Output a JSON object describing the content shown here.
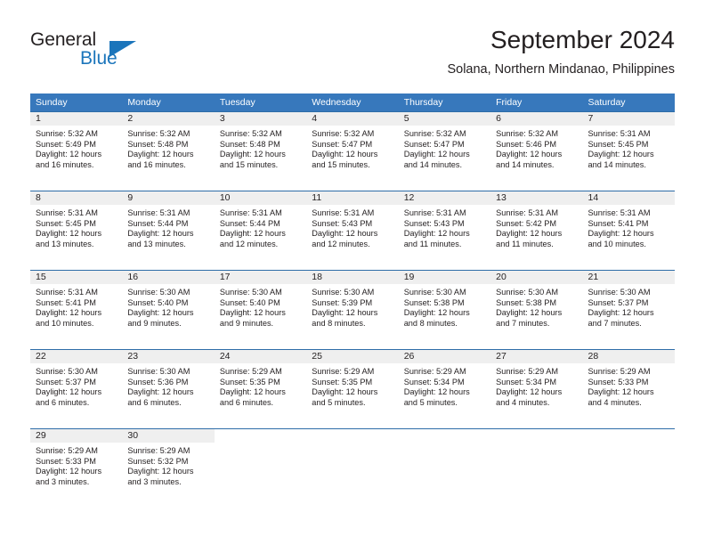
{
  "brand": {
    "name_part1": "General",
    "name_part2": "Blue",
    "accent_color": "#1b75bb"
  },
  "header": {
    "title": "September 2024",
    "subtitle": "Solana, Northern Mindanao, Philippines"
  },
  "theme": {
    "header_bg": "#3778bc",
    "daynum_bg": "#efefef",
    "border": "#2e6da8",
    "text": "#231f20"
  },
  "calendar": {
    "weekday_headers": [
      "Sunday",
      "Monday",
      "Tuesday",
      "Wednesday",
      "Thursday",
      "Friday",
      "Saturday"
    ],
    "weeks": [
      [
        {
          "day": "1",
          "sunrise": "Sunrise: 5:32 AM",
          "sunset": "Sunset: 5:49 PM",
          "daylight1": "Daylight: 12 hours",
          "daylight2": "and 16 minutes."
        },
        {
          "day": "2",
          "sunrise": "Sunrise: 5:32 AM",
          "sunset": "Sunset: 5:48 PM",
          "daylight1": "Daylight: 12 hours",
          "daylight2": "and 16 minutes."
        },
        {
          "day": "3",
          "sunrise": "Sunrise: 5:32 AM",
          "sunset": "Sunset: 5:48 PM",
          "daylight1": "Daylight: 12 hours",
          "daylight2": "and 15 minutes."
        },
        {
          "day": "4",
          "sunrise": "Sunrise: 5:32 AM",
          "sunset": "Sunset: 5:47 PM",
          "daylight1": "Daylight: 12 hours",
          "daylight2": "and 15 minutes."
        },
        {
          "day": "5",
          "sunrise": "Sunrise: 5:32 AM",
          "sunset": "Sunset: 5:47 PM",
          "daylight1": "Daylight: 12 hours",
          "daylight2": "and 14 minutes."
        },
        {
          "day": "6",
          "sunrise": "Sunrise: 5:32 AM",
          "sunset": "Sunset: 5:46 PM",
          "daylight1": "Daylight: 12 hours",
          "daylight2": "and 14 minutes."
        },
        {
          "day": "7",
          "sunrise": "Sunrise: 5:31 AM",
          "sunset": "Sunset: 5:45 PM",
          "daylight1": "Daylight: 12 hours",
          "daylight2": "and 14 minutes."
        }
      ],
      [
        {
          "day": "8",
          "sunrise": "Sunrise: 5:31 AM",
          "sunset": "Sunset: 5:45 PM",
          "daylight1": "Daylight: 12 hours",
          "daylight2": "and 13 minutes."
        },
        {
          "day": "9",
          "sunrise": "Sunrise: 5:31 AM",
          "sunset": "Sunset: 5:44 PM",
          "daylight1": "Daylight: 12 hours",
          "daylight2": "and 13 minutes."
        },
        {
          "day": "10",
          "sunrise": "Sunrise: 5:31 AM",
          "sunset": "Sunset: 5:44 PM",
          "daylight1": "Daylight: 12 hours",
          "daylight2": "and 12 minutes."
        },
        {
          "day": "11",
          "sunrise": "Sunrise: 5:31 AM",
          "sunset": "Sunset: 5:43 PM",
          "daylight1": "Daylight: 12 hours",
          "daylight2": "and 12 minutes."
        },
        {
          "day": "12",
          "sunrise": "Sunrise: 5:31 AM",
          "sunset": "Sunset: 5:43 PM",
          "daylight1": "Daylight: 12 hours",
          "daylight2": "and 11 minutes."
        },
        {
          "day": "13",
          "sunrise": "Sunrise: 5:31 AM",
          "sunset": "Sunset: 5:42 PM",
          "daylight1": "Daylight: 12 hours",
          "daylight2": "and 11 minutes."
        },
        {
          "day": "14",
          "sunrise": "Sunrise: 5:31 AM",
          "sunset": "Sunset: 5:41 PM",
          "daylight1": "Daylight: 12 hours",
          "daylight2": "and 10 minutes."
        }
      ],
      [
        {
          "day": "15",
          "sunrise": "Sunrise: 5:31 AM",
          "sunset": "Sunset: 5:41 PM",
          "daylight1": "Daylight: 12 hours",
          "daylight2": "and 10 minutes."
        },
        {
          "day": "16",
          "sunrise": "Sunrise: 5:30 AM",
          "sunset": "Sunset: 5:40 PM",
          "daylight1": "Daylight: 12 hours",
          "daylight2": "and 9 minutes."
        },
        {
          "day": "17",
          "sunrise": "Sunrise: 5:30 AM",
          "sunset": "Sunset: 5:40 PM",
          "daylight1": "Daylight: 12 hours",
          "daylight2": "and 9 minutes."
        },
        {
          "day": "18",
          "sunrise": "Sunrise: 5:30 AM",
          "sunset": "Sunset: 5:39 PM",
          "daylight1": "Daylight: 12 hours",
          "daylight2": "and 8 minutes."
        },
        {
          "day": "19",
          "sunrise": "Sunrise: 5:30 AM",
          "sunset": "Sunset: 5:38 PM",
          "daylight1": "Daylight: 12 hours",
          "daylight2": "and 8 minutes."
        },
        {
          "day": "20",
          "sunrise": "Sunrise: 5:30 AM",
          "sunset": "Sunset: 5:38 PM",
          "daylight1": "Daylight: 12 hours",
          "daylight2": "and 7 minutes."
        },
        {
          "day": "21",
          "sunrise": "Sunrise: 5:30 AM",
          "sunset": "Sunset: 5:37 PM",
          "daylight1": "Daylight: 12 hours",
          "daylight2": "and 7 minutes."
        }
      ],
      [
        {
          "day": "22",
          "sunrise": "Sunrise: 5:30 AM",
          "sunset": "Sunset: 5:37 PM",
          "daylight1": "Daylight: 12 hours",
          "daylight2": "and 6 minutes."
        },
        {
          "day": "23",
          "sunrise": "Sunrise: 5:30 AM",
          "sunset": "Sunset: 5:36 PM",
          "daylight1": "Daylight: 12 hours",
          "daylight2": "and 6 minutes."
        },
        {
          "day": "24",
          "sunrise": "Sunrise: 5:29 AM",
          "sunset": "Sunset: 5:35 PM",
          "daylight1": "Daylight: 12 hours",
          "daylight2": "and 6 minutes."
        },
        {
          "day": "25",
          "sunrise": "Sunrise: 5:29 AM",
          "sunset": "Sunset: 5:35 PM",
          "daylight1": "Daylight: 12 hours",
          "daylight2": "and 5 minutes."
        },
        {
          "day": "26",
          "sunrise": "Sunrise: 5:29 AM",
          "sunset": "Sunset: 5:34 PM",
          "daylight1": "Daylight: 12 hours",
          "daylight2": "and 5 minutes."
        },
        {
          "day": "27",
          "sunrise": "Sunrise: 5:29 AM",
          "sunset": "Sunset: 5:34 PM",
          "daylight1": "Daylight: 12 hours",
          "daylight2": "and 4 minutes."
        },
        {
          "day": "28",
          "sunrise": "Sunrise: 5:29 AM",
          "sunset": "Sunset: 5:33 PM",
          "daylight1": "Daylight: 12 hours",
          "daylight2": "and 4 minutes."
        }
      ],
      [
        {
          "day": "29",
          "sunrise": "Sunrise: 5:29 AM",
          "sunset": "Sunset: 5:33 PM",
          "daylight1": "Daylight: 12 hours",
          "daylight2": "and 3 minutes."
        },
        {
          "day": "30",
          "sunrise": "Sunrise: 5:29 AM",
          "sunset": "Sunset: 5:32 PM",
          "daylight1": "Daylight: 12 hours",
          "daylight2": "and 3 minutes."
        },
        {
          "day": "",
          "sunrise": "",
          "sunset": "",
          "daylight1": "",
          "daylight2": ""
        },
        {
          "day": "",
          "sunrise": "",
          "sunset": "",
          "daylight1": "",
          "daylight2": ""
        },
        {
          "day": "",
          "sunrise": "",
          "sunset": "",
          "daylight1": "",
          "daylight2": ""
        },
        {
          "day": "",
          "sunrise": "",
          "sunset": "",
          "daylight1": "",
          "daylight2": ""
        },
        {
          "day": "",
          "sunrise": "",
          "sunset": "",
          "daylight1": "",
          "daylight2": ""
        }
      ]
    ]
  }
}
